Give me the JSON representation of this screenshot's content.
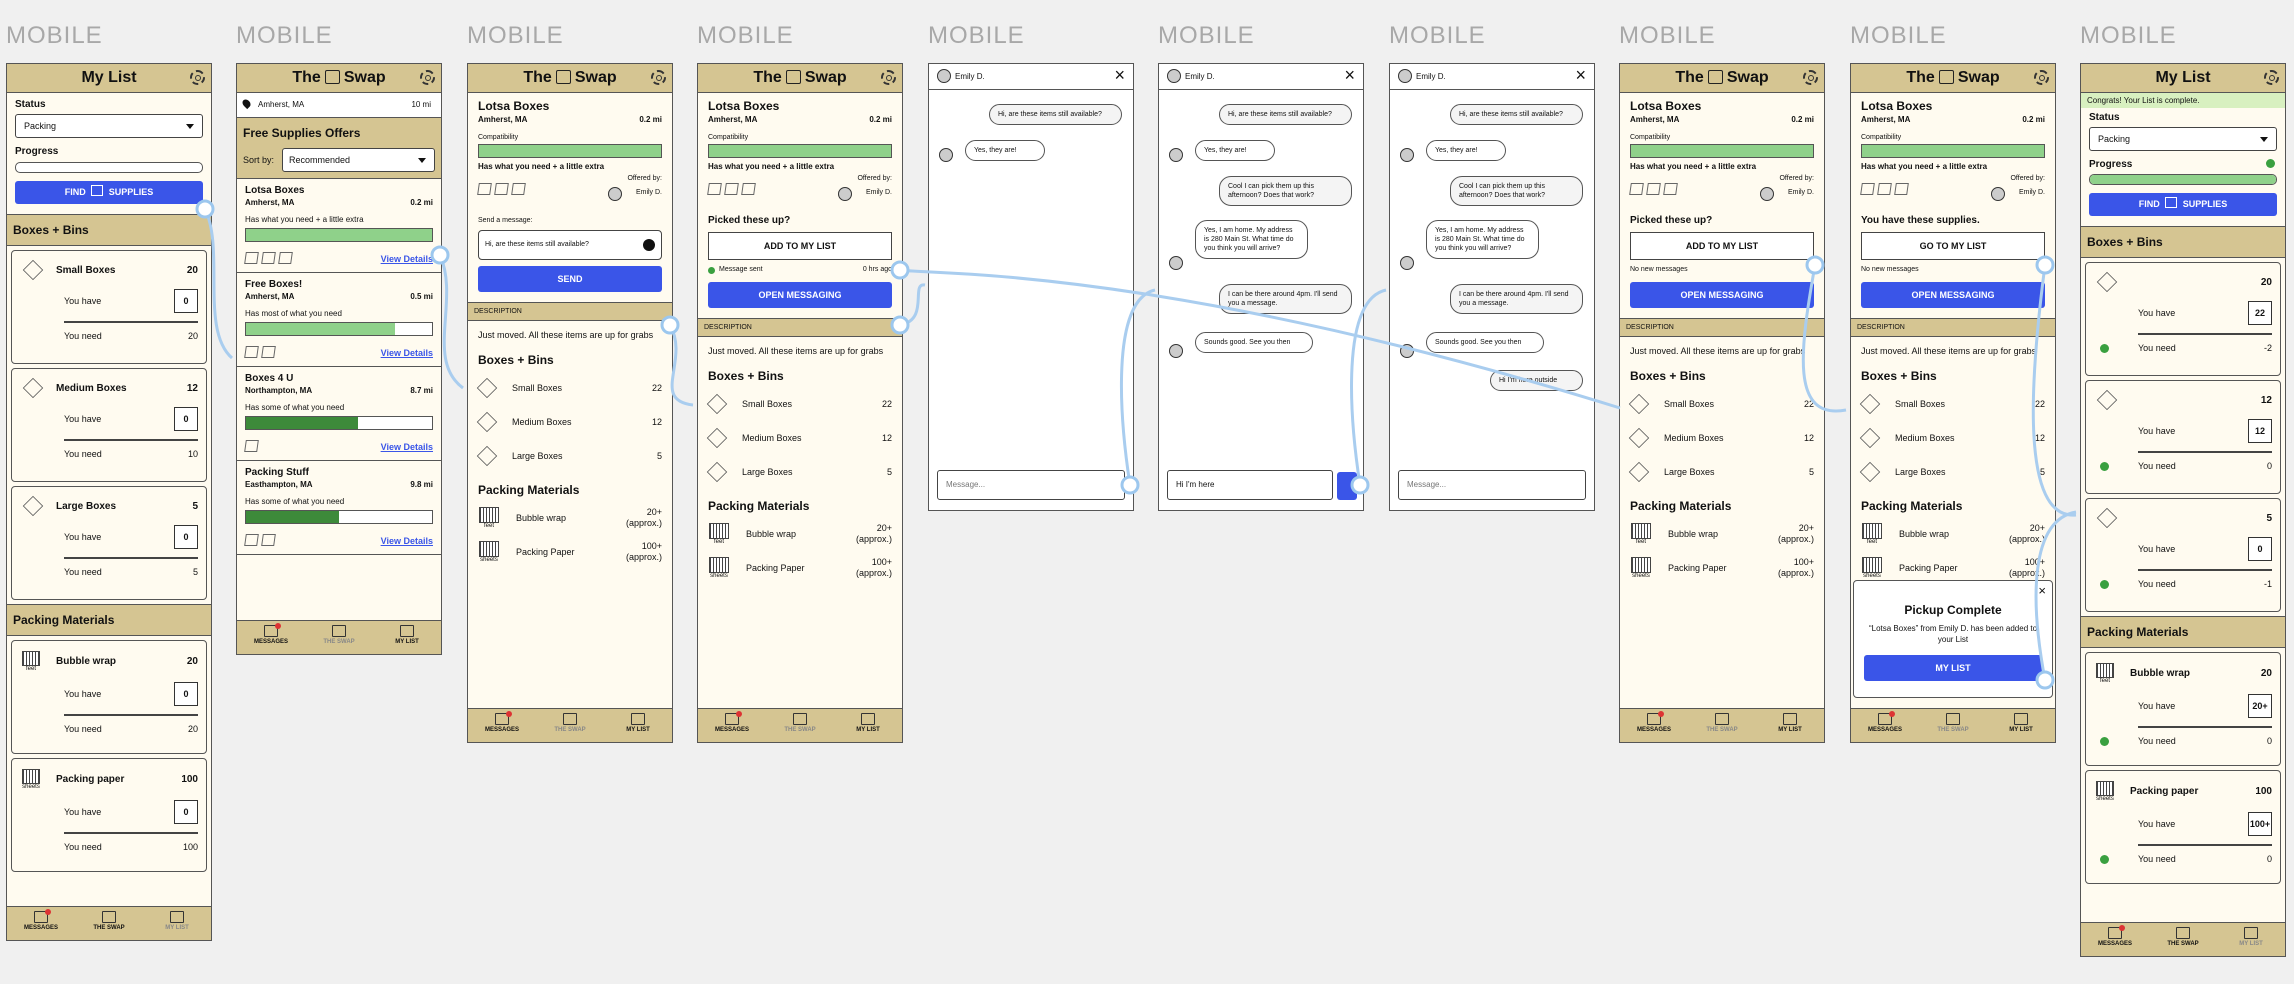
{
  "labels": {
    "mobile": "MOBILE"
  },
  "tabs": {
    "messages": "MESSAGES",
    "swap": "THE SWAP",
    "mylist": "MY LIST"
  },
  "titles": {
    "mylist": "My List",
    "the": "The",
    "swap": "Swap"
  },
  "mylist": {
    "status_label": "Status",
    "status_value": "Packing",
    "progress_label": "Progress",
    "progress_initial": 0.0,
    "progress_final": 1.0,
    "find_btn": "FIND",
    "find_btn2": "SUPPLIES",
    "boxes_section": "Boxes + Bins",
    "packing_section": "Packing Materials",
    "you_have": "You have",
    "you_need": "You need",
    "congrats": "Congrats! Your List is complete.",
    "items": [
      {
        "name": "Small Boxes",
        "qty": "20",
        "have": "0",
        "need": "20",
        "have_final": "22",
        "need_final": "-2"
      },
      {
        "name": "Medium Boxes",
        "qty": "12",
        "have": "0",
        "need": "10",
        "have_final": "12",
        "need_final": "0"
      },
      {
        "name": "Large Boxes",
        "qty": "5",
        "have": "0",
        "need": "5",
        "have_final": "0",
        "need_final": "-1"
      }
    ],
    "materials": [
      {
        "name": "Bubble wrap",
        "name_final": "Bubble wrap",
        "unit": "feet",
        "qty": "20",
        "have": "0",
        "need": "20",
        "have_final": "20+",
        "need_final": "0"
      },
      {
        "name": "Packing paper",
        "name_final": "Packing paper",
        "unit": "sheets",
        "qty": "100",
        "have": "0",
        "need": "100",
        "have_final": "100+",
        "need_final": "0"
      }
    ]
  },
  "swap": {
    "location": "Amherst, MA",
    "radius": "10 mi",
    "offers_title": "Free Supplies Offers",
    "sort_label": "Sort by:",
    "sort_value": "Recommended",
    "view": "View Details",
    "offers": [
      {
        "name": "Lotsa Boxes",
        "loc": "Amherst, MA",
        "dist": "0.2 mi",
        "match": "Has what you need + a little extra",
        "fill": 1.0
      },
      {
        "name": "Free Boxes!",
        "loc": "Amherst, MA",
        "dist": "0.5 mi",
        "match": "Has most of what you need",
        "fill": 0.8
      },
      {
        "name": "Boxes 4 U",
        "loc": "Northampton, MA",
        "dist": "8.7 mi",
        "match": "Has some of what you need",
        "fill": 0.6
      },
      {
        "name": "Packing Stuff",
        "loc": "Easthampton, MA",
        "dist": "9.8 mi",
        "match": "Has some of what you need",
        "fill": 0.5
      }
    ]
  },
  "detail": {
    "name": "Lotsa Boxes",
    "loc": "Amherst, MA",
    "dist": "0.2 mi",
    "compat": "Compatibility",
    "match": "Has what you need + a little extra",
    "offered_by": "Offered by:",
    "offerer": "Emily D.",
    "send_label": "Send a message:",
    "send_text": "Hi, are these items still available?",
    "send_btn": "SEND",
    "picked": "Picked these up?",
    "add_btn": "ADD TO MY LIST",
    "sent": "Message sent",
    "sent_time": "0 hrs ago",
    "open_btn": "OPEN MESSAGING",
    "no_new": "No new messages",
    "have_supplies": "You have these supplies.",
    "goto_btn": "GO TO MY LIST",
    "desc_head": "DESCRIPTION",
    "desc": "Just moved. All these items are up for grabs",
    "boxes_section": "Boxes + Bins",
    "packing_section": "Packing Materials",
    "items": [
      {
        "name": "Small Boxes",
        "qty": "22"
      },
      {
        "name": "Medium Boxes",
        "qty": "12"
      },
      {
        "name": "Large Boxes",
        "qty": "5"
      }
    ],
    "materials": [
      {
        "name": "Bubble wrap",
        "unit": "feet",
        "qty": "20+",
        "qty2": "(approx.)"
      },
      {
        "name": "Packing Paper",
        "unit": "sheets",
        "qty": "100+",
        "qty2": "(approx.)"
      }
    ],
    "modal_title": "Pickup Complete",
    "modal_text": "“Lotsa Boxes” from Emily D. has been added to your List",
    "modal_btn": "MY LIST"
  },
  "chat": {
    "contact": "Emily D.",
    "placeholder": "Message...",
    "typed": "Hi I'm here",
    "m1": "Hi, are these items still available?",
    "m2": "Yes, they are!",
    "m3": "Cool I can pick them up this afternoon? Does that work?",
    "m4": "Yes, I am home. My address is 280 Main St. What time do you think you will arrive?",
    "m5": "I can be there around 4pm. I'll send you a message.",
    "m6": "Sounds good. See you then",
    "m7": "Hi I'm here outside"
  },
  "colors": {
    "accent": "#3a55e8",
    "header": "#d5c592",
    "bg": "#fffbf0",
    "green": "#8fd18a",
    "flow": "#a9cdef"
  }
}
